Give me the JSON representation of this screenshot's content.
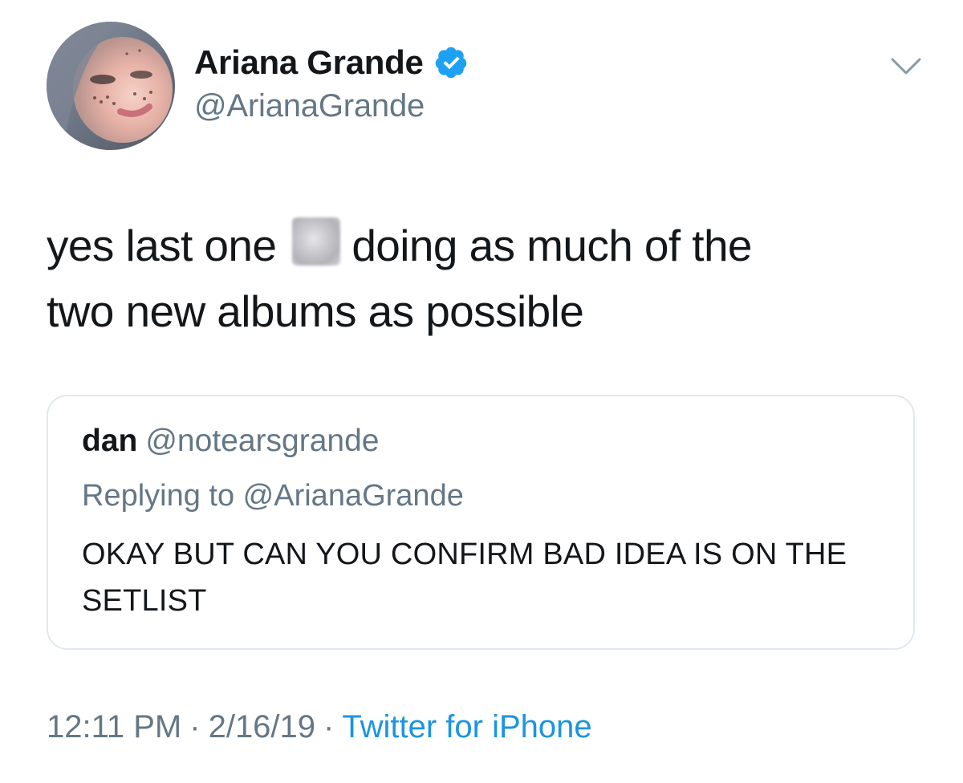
{
  "author": {
    "display_name": "Ariana Grande",
    "handle": "@ArianaGrande",
    "verified_icon": "verified-badge-icon",
    "avatar_icon": "profile-photo"
  },
  "menu_icon": "chevron-down-icon",
  "tweet": {
    "text_before_emoji": "yes last one",
    "emoji": "blurred-emoji",
    "text_after_emoji_line1": "doing as much of the",
    "text_line2": "two new albums as possible"
  },
  "quoted_tweet": {
    "name": "dan",
    "handle": "@notearsgrande",
    "replying_to": "Replying to @ArianaGrande",
    "text": "OKAY BUT CAN YOU CONFIRM BAD IDEA IS ON THE SETLIST"
  },
  "meta": {
    "time": "12:11 PM",
    "separator": "·",
    "date": "2/16/19",
    "source": "Twitter for iPhone"
  },
  "colors": {
    "text_primary": "#14171a",
    "text_secondary": "#657786",
    "link_blue": "#1b95e0",
    "verified_blue": "#1da1f2",
    "border": "#e1e8ed"
  }
}
